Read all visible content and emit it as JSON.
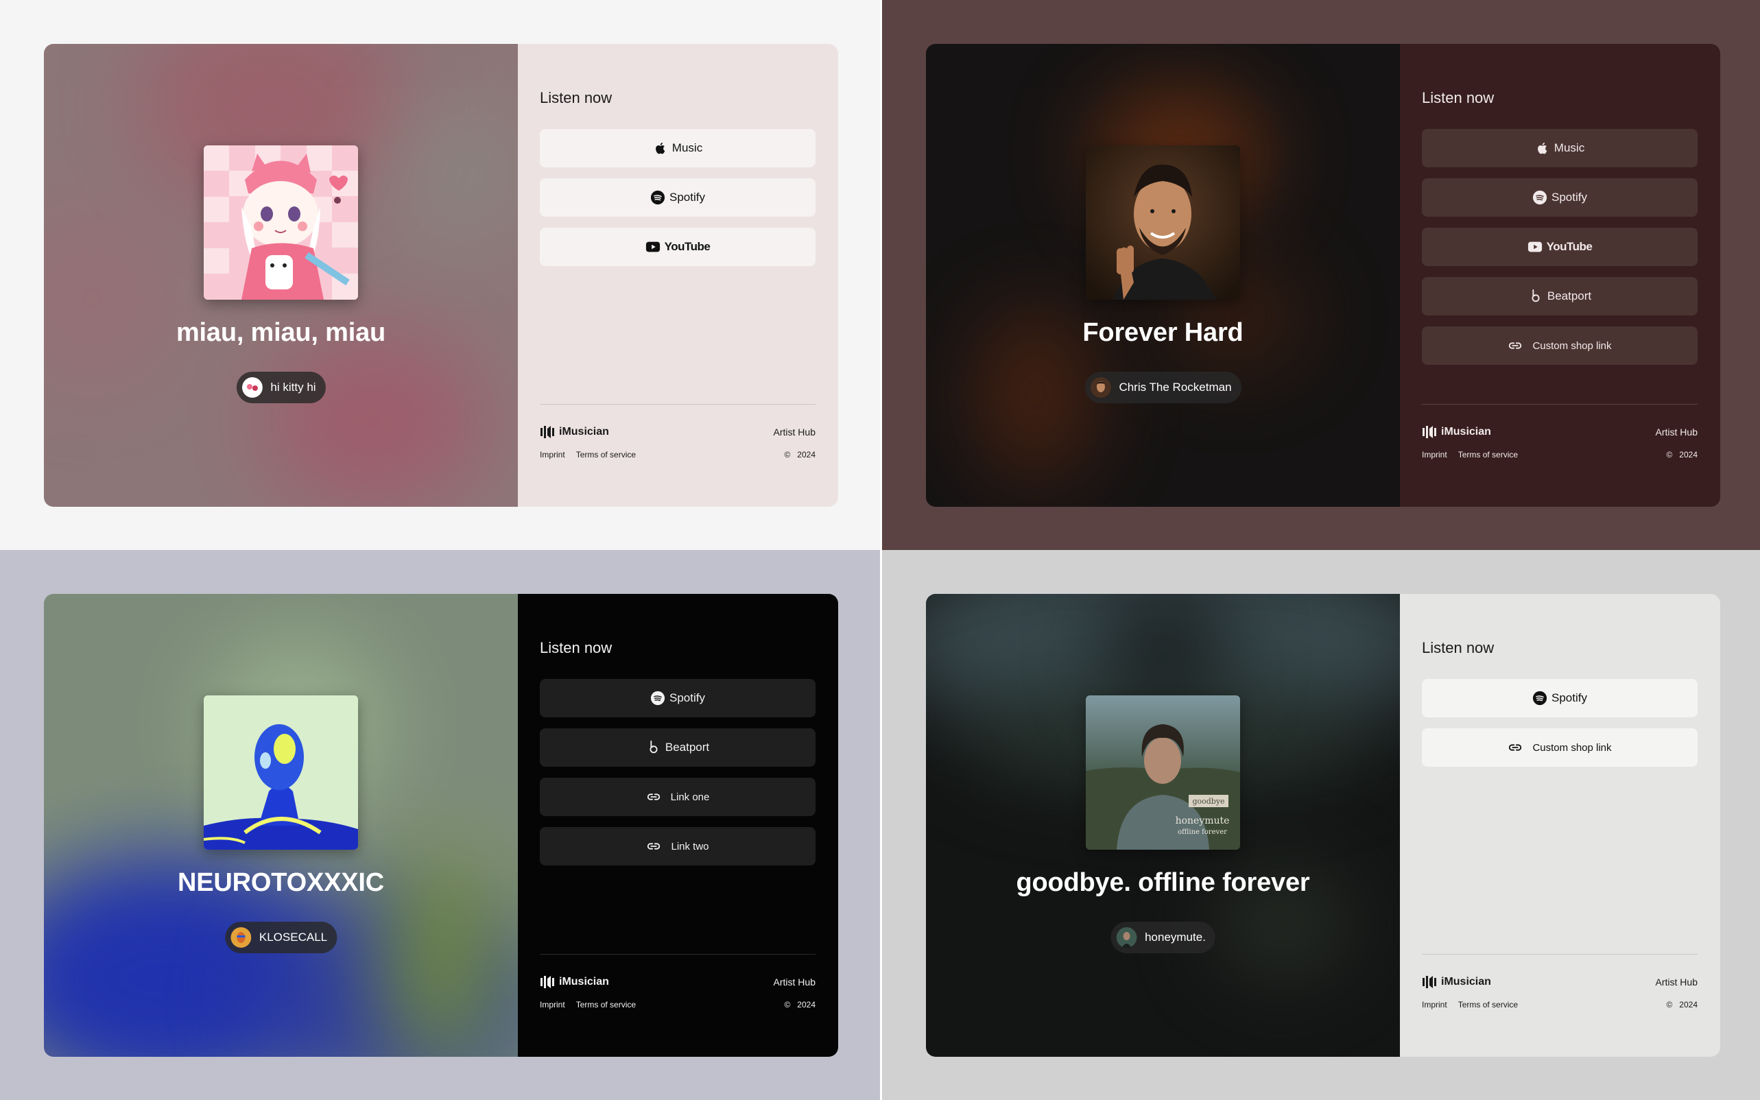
{
  "cards": [
    {
      "theme": "pink",
      "release_title": "miau, miau, miau",
      "artist": "hi kitty hi",
      "listen_heading": "Listen now",
      "links": [
        "Music",
        "Spotify",
        "YouTube"
      ],
      "footer": {
        "brand": "iMusician",
        "hub": "Artist Hub",
        "imprint": "Imprint",
        "terms": "Terms of service",
        "copyright_symbol": "©",
        "year": "2024"
      }
    },
    {
      "theme": "brown",
      "release_title": "Forever Hard",
      "artist": "Chris The Rocketman",
      "listen_heading": "Listen now",
      "links": [
        "Music",
        "Spotify",
        "YouTube",
        "Beatport",
        "Custom shop link"
      ],
      "footer": {
        "brand": "iMusician",
        "hub": "Artist Hub",
        "imprint": "Imprint",
        "terms": "Terms of service",
        "copyright_symbol": "©",
        "year": "2024"
      }
    },
    {
      "theme": "black",
      "release_title": "NEUROTOXXXIC",
      "artist": "KLOSECALL",
      "listen_heading": "Listen now",
      "links": [
        "Spotify",
        "Beatport",
        "Link one",
        "Link two"
      ],
      "footer": {
        "brand": "iMusician",
        "hub": "Artist Hub",
        "imprint": "Imprint",
        "terms": "Terms of service",
        "copyright_symbol": "©",
        "year": "2024"
      }
    },
    {
      "theme": "grey",
      "release_title": "goodbye. offline forever",
      "artist": "honeymute.",
      "cover_text": {
        "tag": "goodbye",
        "artist": "honeymute",
        "title": "offline forever"
      },
      "listen_heading": "Listen now",
      "links": [
        "Spotify",
        "Custom shop link"
      ],
      "footer": {
        "brand": "iMusician",
        "hub": "Artist Hub",
        "imprint": "Imprint",
        "terms": "Terms of service",
        "copyright_symbol": "©",
        "year": "2024"
      }
    }
  ],
  "icons": {
    "apple_music": "apple-icon",
    "spotify": "spotify-icon",
    "youtube": "youtube-play-icon",
    "beatport": "beatport-icon",
    "link": "link-chain-icon",
    "brand": "imusician-logo-icon"
  }
}
